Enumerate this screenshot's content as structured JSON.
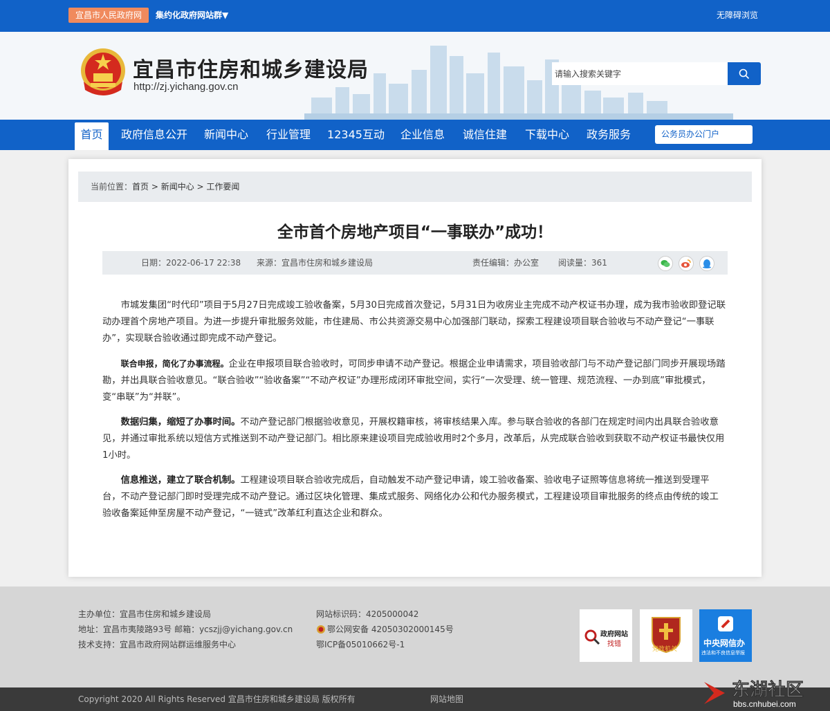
{
  "topbar": {
    "gov_tag": "宜昌市人民政府网",
    "group_link": "集约化政府网站群▼",
    "accessibility": "无障碍浏览"
  },
  "header": {
    "title": "宜昌市住房和城乡建设局",
    "url": "http://zj.yichang.gov.cn",
    "search_placeholder": "请输入搜索关键字"
  },
  "nav": {
    "items": [
      {
        "label": "首页"
      },
      {
        "label": "政府信息公开"
      },
      {
        "label": "新闻中心"
      },
      {
        "label": "行业管理"
      },
      {
        "label": "12345互动"
      },
      {
        "label": "企业信息"
      },
      {
        "label": "诚信住建"
      },
      {
        "label": "下载中心"
      },
      {
        "label": "政务服务"
      }
    ],
    "portal": "公务员办公门户"
  },
  "breadcrumb": {
    "prefix": "当前位置：",
    "home": "首页",
    "sep1": " > ",
    "section": "新闻中心",
    "sep2": " > ",
    "current": "工作要闻"
  },
  "article": {
    "title": "全市首个房地产项目“一事联办”成功！",
    "date": "日期：2022-06-17 22:38",
    "source": "来源：宜昌市住房和城乡建设局",
    "editor": "责任编辑：办公室",
    "reads": "阅读量：361",
    "p1": "市城发集团“时代印”项目于5月27日完成竣工验收备案，5月30日完成首次登记，5月31日为收房业主完成不动产权证书办理，成为我市验收即登记联动办理首个房地产项目。为进一步提升审批服务效能，市住建局、市公共资源交易中心加强部门联动，探索工程建设项目联合验收与不动产登记“一事联办”，实现联合验收通过即完成不动产登记。",
    "p2_bold": "联合申报，简化了办事流程。",
    "p2": "企业在申报项目联合验收时，可同步申请不动产登记。根据企业申请需求，项目验收部门与不动产登记部门同步开展现场踏勘，并出具联合验收意见。“联合验收”“验收备案”“不动产权证”办理形成闭环审批空间，实行“一次受理、统一管理、规范流程、一办到底”审批模式，变“串联”为“并联”。",
    "p3_bold": "数据归集，缩短了办事时间。",
    "p3": "不动产登记部门根据验收意见，开展权籍审核，将审核结果入库。参与联合验收的各部门在规定时间内出具联合验收意见，并通过审批系统以短信方式推送到不动产登记部门。相比原来建设项目完成验收用时2个多月，改革后，从完成联合验收到获取不动产权证书最快仅用1小时。",
    "p4_bold": "信息推送，建立了联合机制。",
    "p4": "工程建设项目联合验收完成后，自动触发不动产登记申请，竣工验收备案、验收电子证照等信息将统一推送到受理平台，不动产登记部门即时受理完成不动产登记。通过区块化管理、集成式服务、网络化办公和代办服务模式，工程建设项目审批服务的终点由传统的竣工验收备案延伸至房屋不动产登记，“一链式”改革红利直达企业和群众。"
  },
  "footer": {
    "sponsor": "主办单位：宜昌市住房和城乡建设局",
    "address": "地址：宜昌市夷陵路93号 邮箱：ycszjj@yichang.gov.cn",
    "support": "技术支持：宜昌市政府网站群运维服务中心",
    "site_id": "网站标识码：4205000042",
    "police": "鄂公网安备 42050302000145号",
    "icp": "鄂ICP备05010662号-1",
    "badge1_line1": "政府网站",
    "badge1_line2": "找错",
    "badge2": "党政机关",
    "badge3_line1": "中央网信办",
    "badge3_line2": "违法和不良信息举报",
    "copyright": "Copyright 2020 All Rights Reserved 宜昌市住房和城乡建设局 版权所有",
    "sitemap": "网站地图"
  },
  "watermark": {
    "text": "东湖社区",
    "url": "bbs.cnhubei.com"
  },
  "colors": {
    "primary_blue": "#1162c8",
    "orange_tag": "#f08a5d",
    "footer_gray": "#d6d6d6",
    "bottom_dark": "#3a3a3a"
  }
}
